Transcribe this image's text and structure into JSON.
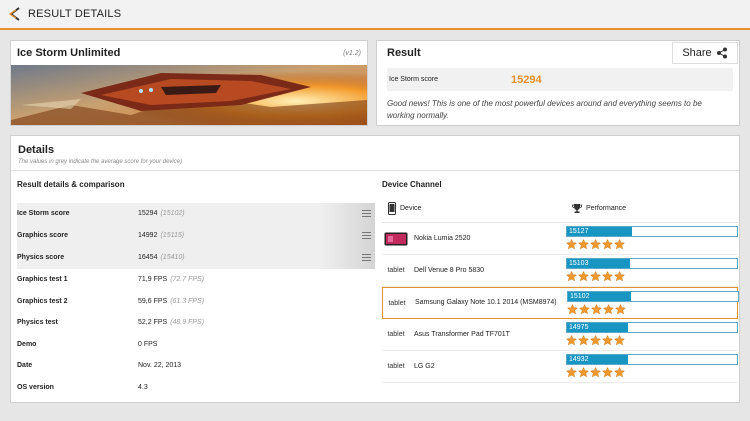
{
  "header": {
    "title": "RESULT DETAILS"
  },
  "test": {
    "name": "Ice Storm Unlimited",
    "version": "(v1.2)"
  },
  "result": {
    "title": "Result",
    "share_label": "Share",
    "score_label": "Ice Storm score",
    "score_value": "15294",
    "message": "Good news! This is one of the most powerful devices around and everything seems to be working normally."
  },
  "details": {
    "title": "Details",
    "subtitle": "The values in grey indicate the average score for your device)",
    "left_title": "Result details & comparison",
    "rows": [
      {
        "label": "Ice Storm score",
        "value": "15294",
        "avg": "(15102)"
      },
      {
        "label": "Graphics score",
        "value": "14992",
        "avg": "(15115)"
      },
      {
        "label": "Physics score",
        "value": "16454",
        "avg": "(15410)"
      },
      {
        "label": "Graphics test 1",
        "value": "71,9 FPS",
        "avg": "(72.7 FPS)"
      },
      {
        "label": "Graphics test 2",
        "value": "59,6 FPS",
        "avg": "(61.3 FPS)"
      },
      {
        "label": "Physics test",
        "value": "52,2 FPS",
        "avg": "(48.9 FPS)"
      },
      {
        "label": "Demo",
        "value": "0 FPS",
        "avg": ""
      },
      {
        "label": "Date",
        "value": "Nov. 22, 2013",
        "avg": ""
      },
      {
        "label": "OS version",
        "value": "4.3",
        "avg": ""
      }
    ]
  },
  "channel": {
    "title": "Device Channel",
    "col_device": "Device",
    "col_performance": "Performance",
    "accent": "#1796c4",
    "devices": [
      {
        "thumb": "",
        "name": "Nokia Lumia 2520",
        "score": "15127",
        "fill": 0.38,
        "stars": 5
      },
      {
        "thumb": "tablet",
        "name": "Dell Venue 8 Pro 5830",
        "score": "15103",
        "fill": 0.37,
        "stars": 5
      },
      {
        "thumb": "tablet",
        "name": "Samsung Galaxy Note 10.1 2014 (MSM8974)",
        "score": "15102",
        "fill": 0.37,
        "stars": 5
      },
      {
        "thumb": "tablet",
        "name": "Asus Transformer Pad TF701T",
        "score": "14975",
        "fill": 0.36,
        "stars": 5
      },
      {
        "thumb": "tablet",
        "name": "LG G2",
        "score": "14932",
        "fill": 0.36,
        "stars": 5
      }
    ]
  }
}
